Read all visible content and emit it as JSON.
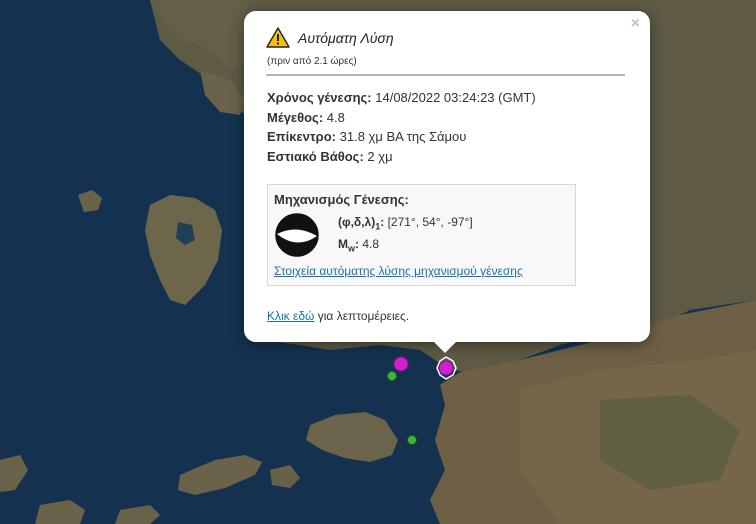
{
  "popup": {
    "close_glyph": "×",
    "title": "Αυτόματη Λύση",
    "subtitle": "(πριν από 2.1 ώρες)",
    "origin_time_label": "Χρόνος γένεσης:",
    "origin_time_value": "14/08/2022 03:24:23 (GMT)",
    "magnitude_label": "Μέγεθος:",
    "magnitude_value": "4.8",
    "epicenter_label": "Επίκεντρο:",
    "epicenter_value": "31.8 χμ ΒΑ της Σάμου",
    "depth_label": "Εστιακό Βάθος:",
    "depth_value": "2 χμ",
    "mechanism": {
      "title": "Μηχανισμός Γένεσης:",
      "params_label": "(φ,δ,λ)",
      "params_subscript": "1",
      "params_value": "[271°, 54°, -97°]",
      "mw_label": "M",
      "mw_subscript": "w",
      "mw_value": "4.8",
      "link_text": "Στοιχεία αυτόματης λύσης μηχανισμού γένεσης"
    },
    "more_link": "Κλικ εδώ",
    "more_text": "για λεπτομέρειες."
  },
  "colors": {
    "sea": "#14324f",
    "land": "#6b6248",
    "event_marker": "#d21ed2",
    "green_marker": "#3fb33f",
    "link": "#1a73a8"
  },
  "icons": [
    "warning-icon",
    "close-icon",
    "beachball-icon"
  ]
}
